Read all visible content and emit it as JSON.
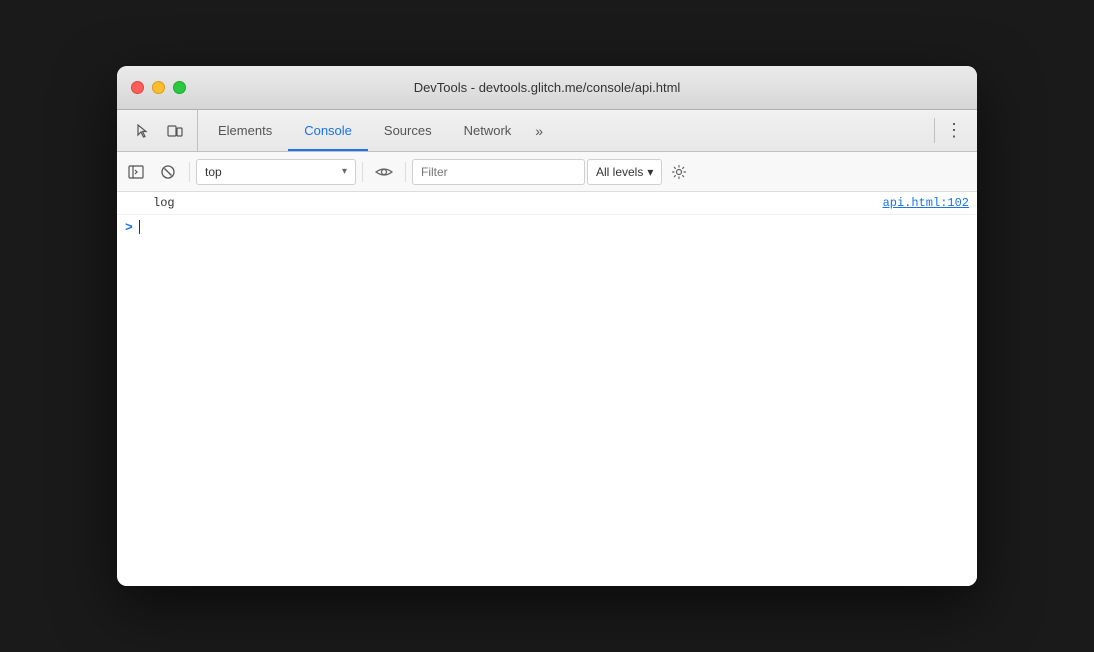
{
  "window": {
    "title": "DevTools - devtools.glitch.me/console/api.html"
  },
  "tabs": {
    "items": [
      {
        "id": "elements",
        "label": "Elements",
        "active": false
      },
      {
        "id": "console",
        "label": "Console",
        "active": true
      },
      {
        "id": "sources",
        "label": "Sources",
        "active": false
      },
      {
        "id": "network",
        "label": "Network",
        "active": false
      }
    ],
    "more_label": "»",
    "menu_label": "⋮"
  },
  "console_toolbar": {
    "context_value": "top",
    "context_arrow": "▾",
    "filter_placeholder": "Filter",
    "levels_label": "All levels",
    "levels_arrow": "▾"
  },
  "console_log": {
    "text": "log",
    "source": "api.html:102"
  },
  "console_input": {
    "prompt": ">"
  },
  "icons": {
    "sidebar_toggle": "sidebar-toggle-icon",
    "cursor": "cursor-icon",
    "device_toggle": "device-toggle-icon",
    "clear_console": "clear-console-icon",
    "live_expression": "live-expression-icon",
    "settings": "settings-icon"
  }
}
